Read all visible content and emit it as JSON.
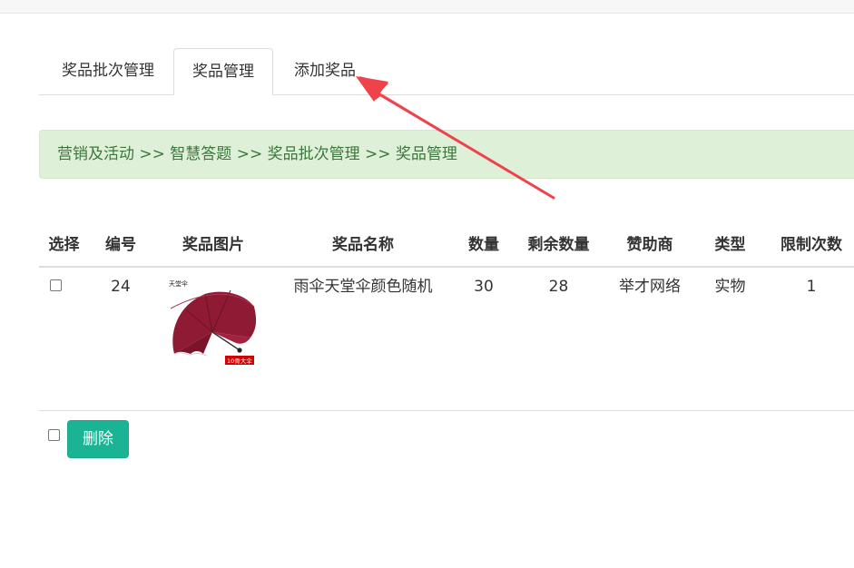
{
  "tabs": [
    {
      "label": "奖品批次管理"
    },
    {
      "label": "奖品管理"
    },
    {
      "label": "添加奖品"
    }
  ],
  "active_tab": "奖品管理",
  "breadcrumb": "营销及活动 >> 智慧答题 >> 奖品批次管理 >> 奖品管理",
  "table": {
    "headers": [
      "选择",
      "编号",
      "奖品图片",
      "奖品名称",
      "数量",
      "剩余数量",
      "赞助商",
      "类型",
      "限制次数"
    ],
    "rows": [
      {
        "id": "24",
        "name": "雨伞天堂伞颜色随机",
        "quantity": "30",
        "remaining": "28",
        "sponsor": "举才网络",
        "type": "实物",
        "limit": "1",
        "image_brand": "天堂伞",
        "image_tag": "10骨大伞"
      }
    ]
  },
  "footer": {
    "delete_label": "删除"
  },
  "colors": {
    "breadcrumb_bg": "#dff0d8",
    "breadcrumb_text": "#3c763d",
    "delete_button": "#1ab394",
    "annotation_arrow": "#f0424a",
    "umbrella": "#8e1a33"
  }
}
